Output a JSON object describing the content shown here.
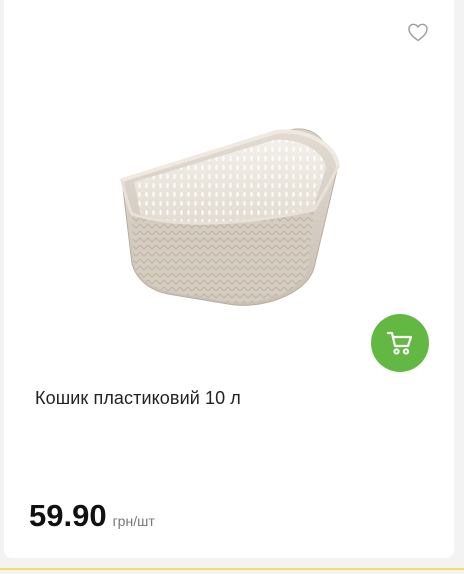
{
  "product": {
    "title": "Кошик пластиковий 10 л",
    "price": "59.90",
    "unit": "грн/шт"
  },
  "icons": {
    "favorite": "heart-outline-icon",
    "cart": "shopping-cart-icon"
  },
  "colors": {
    "cart_button": "#63b844",
    "price_text": "#111111",
    "bottom_accent": "#f2dd6a"
  }
}
